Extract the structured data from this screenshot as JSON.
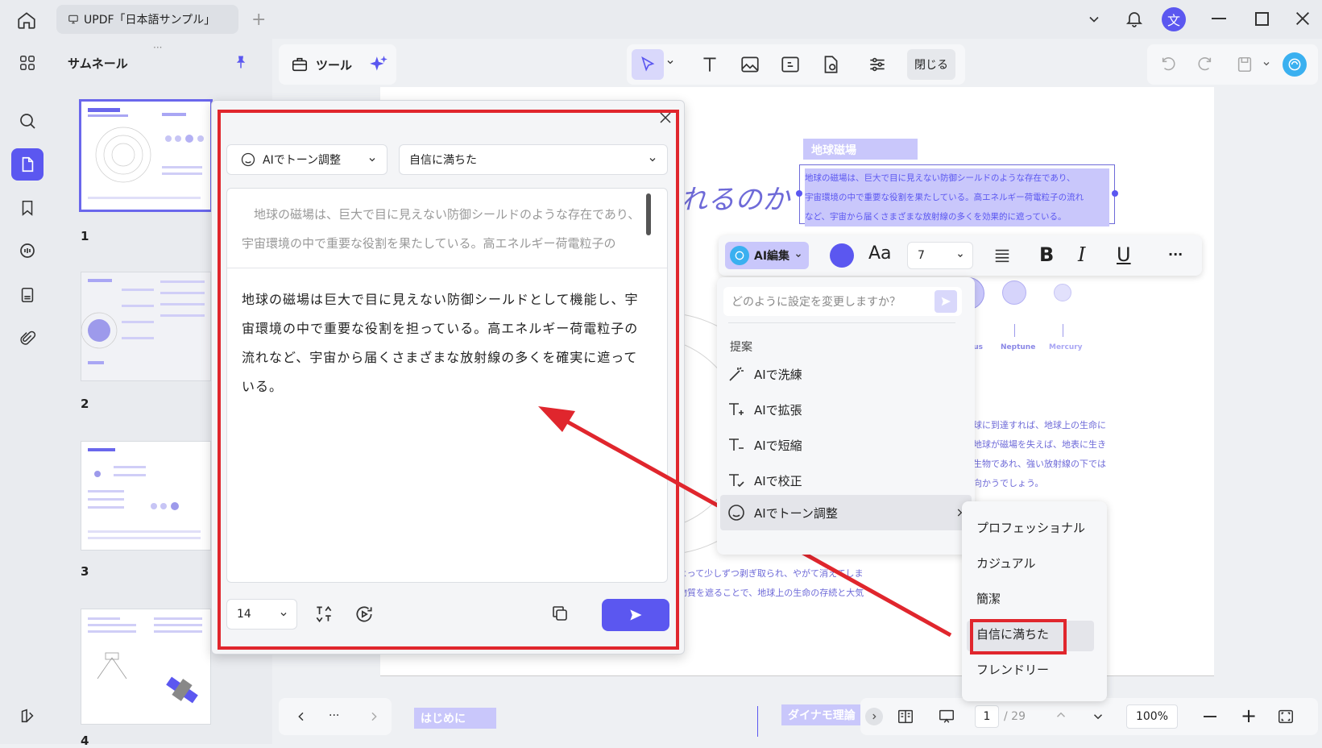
{
  "window": {
    "tab_title": "UPDF「日本語サンプル」"
  },
  "sidebar": {
    "panel_title": "サムネール",
    "page_numbers": [
      "1",
      "2",
      "3",
      "4"
    ]
  },
  "toolbar": {
    "tools_label": "ツール",
    "close_label": "閉じる"
  },
  "document": {
    "heading": "地球磁場",
    "selected_text": [
      "地球の磁場は、巨大で目に見えない防御シールドのような存在であり、",
      "宇宙環境の中で重要な役割を果たしている。高エネルギー荷電粒子の流れ",
      "など、宇宙から届くさまざまな放射線の多くを効果的に遮っている。"
    ],
    "title_fragment": "れるのか",
    "planet_labels": [
      "Uranus",
      "Neptune",
      "Mercury"
    ],
    "right_paragraph": [
      "球に到達すれば、地球上の生命に",
      "地球が磁場を失えば、地表に生き",
      "生物であれ、強い放射線の下では",
      "向かうでしょう。"
    ],
    "bottom_paragraph": [
      "よって少しずつ剥ぎ取られ、やがて消えてしま",
      "物質を遮ることで、地球上の生命の存続と大気"
    ],
    "footer_left_label": "はじめに",
    "footer_right_label": "ダイナモ理論"
  },
  "dialog": {
    "mode_select": "AIでトーン調整",
    "tone_select": "自信に満ちた",
    "original_text": "　地球の磁場は、巨大で目に見えない防御シールドのような存在であり、宇宙環境の中で重要な役割を果たしている。高エネルギー荷電粒子の",
    "result_text": "地球の磁場は巨大で目に見えない防御シールドとして機能し、宇宙環境の中で重要な役割を担っている。高エネルギー荷電粒子の流れなど、宇宙から届くさまざまな放射線の多くを確実に遮っている。",
    "font_size": "14"
  },
  "ai_toolbar": {
    "ai_edit_label": "AI編集",
    "font_size_value": "7",
    "font_label": "Aa",
    "bold_label": "B",
    "italic_label": "I",
    "underline_label": "U",
    "more_label": "···",
    "prompt_placeholder": "どのように設定を変更しますか？",
    "suggestions_title": "提案",
    "items": [
      "AIで洗練",
      "AIで拡張",
      "AIで短縮",
      "AIで校正",
      "AIでトーン調整"
    ]
  },
  "tone_menu": {
    "options": [
      "プロフェッショナル",
      "カジュアル",
      "簡潔",
      "自信に満ちた",
      "フレンドリー"
    ]
  },
  "bottom_nav": {
    "more_label": "···",
    "current_page": "1",
    "total_pages": "/ 29",
    "zoom": "100%"
  },
  "colors": {
    "accent": "#5b57f0",
    "highlight_red": "#e0262d",
    "selection": "#c9c7fb",
    "doc_text": "#6e6ad8"
  },
  "avatar_letter": "文"
}
